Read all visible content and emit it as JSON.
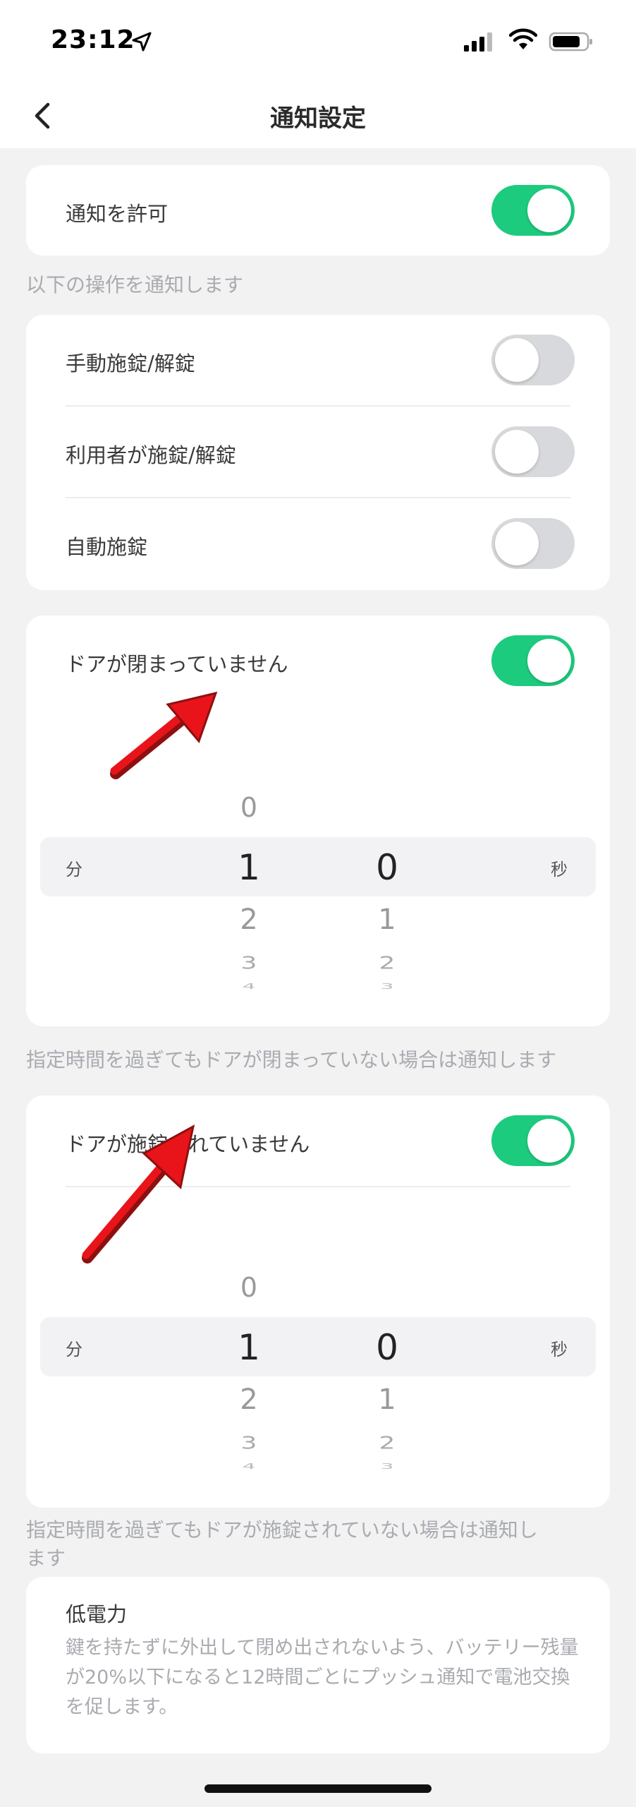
{
  "status_bar": {
    "time": "23:12"
  },
  "nav": {
    "title": "通知設定"
  },
  "allow_card": {
    "label": "通知を許可",
    "enabled": true
  },
  "ops_note": "以下の操作を通知します",
  "ops_card": {
    "items": [
      {
        "label": "手動施錠/解錠",
        "enabled": false
      },
      {
        "label": "利用者が施錠/解錠",
        "enabled": false
      },
      {
        "label": "自動施錠",
        "enabled": false
      }
    ]
  },
  "door_open_card": {
    "label": "ドアが閉まっていません",
    "enabled": true,
    "picker": {
      "min_unit": "分",
      "sec_unit": "秒",
      "min_above": "0",
      "min_selected": "1",
      "min_below": [
        "2",
        "3",
        "4"
      ],
      "sec_selected": "0",
      "sec_below": [
        "1",
        "2",
        "3"
      ]
    }
  },
  "door_open_note": "指定時間を過ぎてもドアが閉まっていない場合は通知します",
  "unlocked_card": {
    "label": "ドアが施錠されていません",
    "enabled": true,
    "picker": {
      "min_unit": "分",
      "sec_unit": "秒",
      "min_above": "0",
      "min_selected": "1",
      "min_below": [
        "2",
        "3",
        "4"
      ],
      "sec_selected": "0",
      "sec_below": [
        "1",
        "2",
        "3"
      ]
    }
  },
  "unlocked_note": "指定時間を過ぎてもドアが施錠されていない場合は通知し\nます",
  "low_power": {
    "title": "低電力",
    "description": "鍵を持たずに外出して閉め出されないよう、バッテリー残量が20%以下になると12時間ごとにプッシュ通知で電池交換を促します。"
  },
  "colors": {
    "toggle_on": "#1dcb7e",
    "toggle_off": "#d8d9dc",
    "annotation_arrow": "#e8141a"
  }
}
